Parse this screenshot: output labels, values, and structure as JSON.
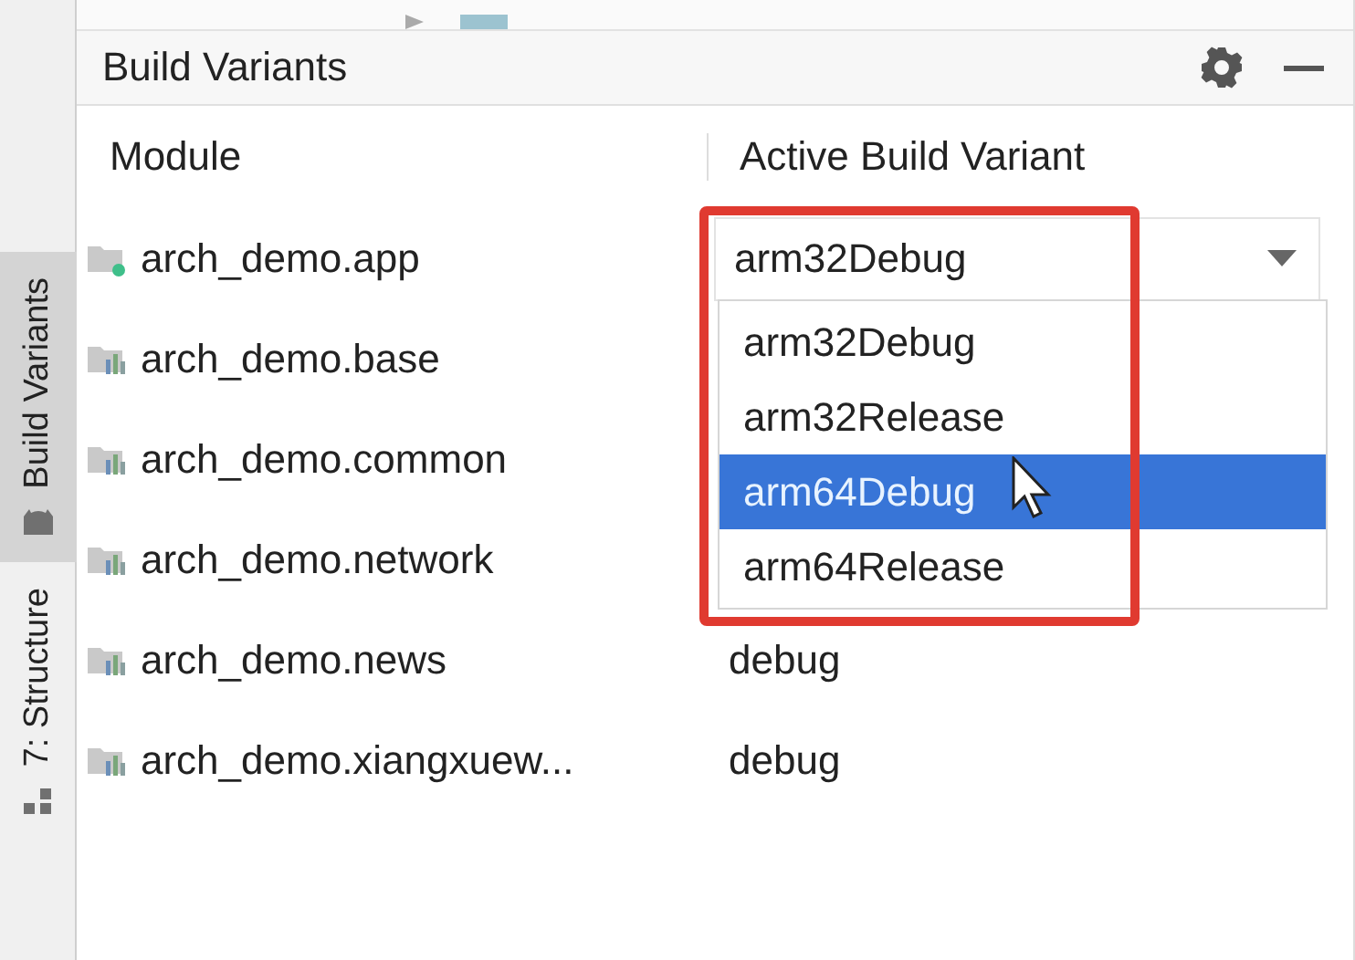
{
  "tool_strip": {
    "tabs": [
      {
        "label": "Build Variants",
        "selected": true,
        "kind": "android"
      },
      {
        "label": "7: Structure",
        "selected": false,
        "kind": "structure"
      }
    ]
  },
  "panel": {
    "title": "Build Variants"
  },
  "table": {
    "columns": [
      "Module",
      "Active Build Variant"
    ],
    "rows": [
      {
        "module": "arch_demo.app",
        "kind": "app",
        "variant": "arm32Debug",
        "expanded": true,
        "options": [
          {
            "label": "arm32Debug",
            "selected": false
          },
          {
            "label": "arm32Release",
            "selected": false
          },
          {
            "label": "arm64Debug",
            "selected": true
          },
          {
            "label": "arm64Release",
            "selected": false
          }
        ]
      },
      {
        "module": "arch_demo.base",
        "kind": "library"
      },
      {
        "module": "arch_demo.common",
        "kind": "library"
      },
      {
        "module": "arch_demo.network",
        "kind": "library"
      },
      {
        "module": "arch_demo.news",
        "kind": "library",
        "variant": "debug"
      },
      {
        "module": "arch_demo.xiangxuew...",
        "kind": "library",
        "variant": "debug"
      }
    ]
  }
}
